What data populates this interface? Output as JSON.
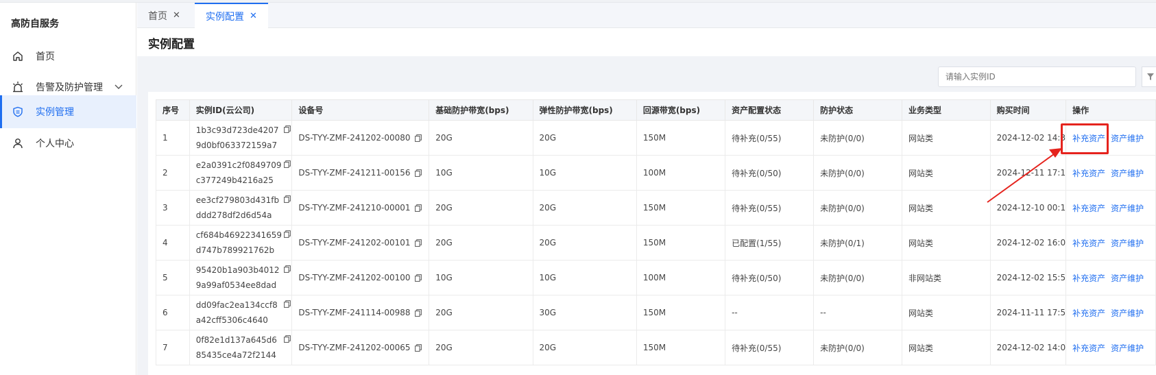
{
  "app": {
    "brand": "高防自服务"
  },
  "sidebar": {
    "items": [
      {
        "label": "首页",
        "icon": "home-icon"
      },
      {
        "label": "告警及防护管理",
        "icon": "alarm-light-icon"
      },
      {
        "label": "实例管理",
        "icon": "shield-icon"
      },
      {
        "label": "个人中心",
        "icon": "user-icon"
      }
    ]
  },
  "tabs": [
    {
      "label": "首页",
      "close": "✕"
    },
    {
      "label": "实例配置",
      "close": "✕"
    }
  ],
  "page": {
    "title": "实例配置"
  },
  "search": {
    "placeholder": "请输入实例ID"
  },
  "table": {
    "headers": [
      "序号",
      "实例ID(云公司)",
      "设备号",
      "基础防护带宽(bps)",
      "弹性防护带宽(bps)",
      "回源带宽(bps)",
      "资产配置状态",
      "防护状态",
      "业务类型",
      "购买时间",
      "操作"
    ],
    "actions": {
      "supplement": "补充资产",
      "maintain": "资产维护"
    },
    "rows": [
      {
        "no": "1",
        "id1": "1b3c93d723de4207",
        "id2": "9d0bf063372159a7",
        "device": "DS-TYY-ZMF-241202-00080",
        "base": "20G",
        "elastic": "20G",
        "back": "150M",
        "asset": "待补充(0/55)",
        "protect": "未防护(0/0)",
        "biz": "网站类",
        "time": "2024-12-02 14:3"
      },
      {
        "no": "2",
        "id1": "e2a0391c2f0849709",
        "id2": "c377249b4216a25",
        "device": "DS-TYY-ZMF-241211-00156",
        "base": "10G",
        "elastic": "10G",
        "back": "100M",
        "asset": "待补充(0/50)",
        "protect": "未防护(0/0)",
        "biz": "网站类",
        "time": "2024-12-11 17:1"
      },
      {
        "no": "3",
        "id1": "ee3cf279803d431fb",
        "id2": "ddd278df2d6d54a",
        "device": "DS-TYY-ZMF-241210-00001",
        "base": "20G",
        "elastic": "20G",
        "back": "150M",
        "asset": "待补充(0/55)",
        "protect": "未防护(0/0)",
        "biz": "网站类",
        "time": "2024-12-10 00:1"
      },
      {
        "no": "4",
        "id1": "cf684b46922341659",
        "id2": "d747b789921762b",
        "device": "DS-TYY-ZMF-241202-00101",
        "base": "20G",
        "elastic": "20G",
        "back": "150M",
        "asset": "已配置(1/55)",
        "protect": "未防护(0/1)",
        "biz": "网站类",
        "time": "2024-12-02 16:0"
      },
      {
        "no": "5",
        "id1": "95420b1a903b4012",
        "id2": "9a99af0534ee8dad",
        "device": "DS-TYY-ZMF-241202-00100",
        "base": "10G",
        "elastic": "10G",
        "back": "100M",
        "asset": "待补充(0/50)",
        "protect": "未防护(0/0)",
        "biz": "非网站类",
        "time": "2024-12-02 15:5"
      },
      {
        "no": "6",
        "id1": "dd09fac2ea134ccf8",
        "id2": "a42cff5306c4640",
        "device": "DS-TYY-ZMF-241114-00988",
        "base": "20G",
        "elastic": "30G",
        "back": "150M",
        "asset": "--",
        "protect": "--",
        "biz": "网站类",
        "time": "2024-11-11 17:5"
      },
      {
        "no": "7",
        "id1": "0f82e1d137a645d6",
        "id2": "85435ce4a72f2144",
        "device": "DS-TYY-ZMF-241202-00065",
        "base": "20G",
        "elastic": "20G",
        "back": "150M",
        "asset": "待补充(0/55)",
        "protect": "未防护(0/0)",
        "biz": "网站类",
        "time": "2024-12-02 14:0"
      }
    ]
  },
  "colors": {
    "accent": "#1f6ef0",
    "highlight": "#e5231d"
  }
}
